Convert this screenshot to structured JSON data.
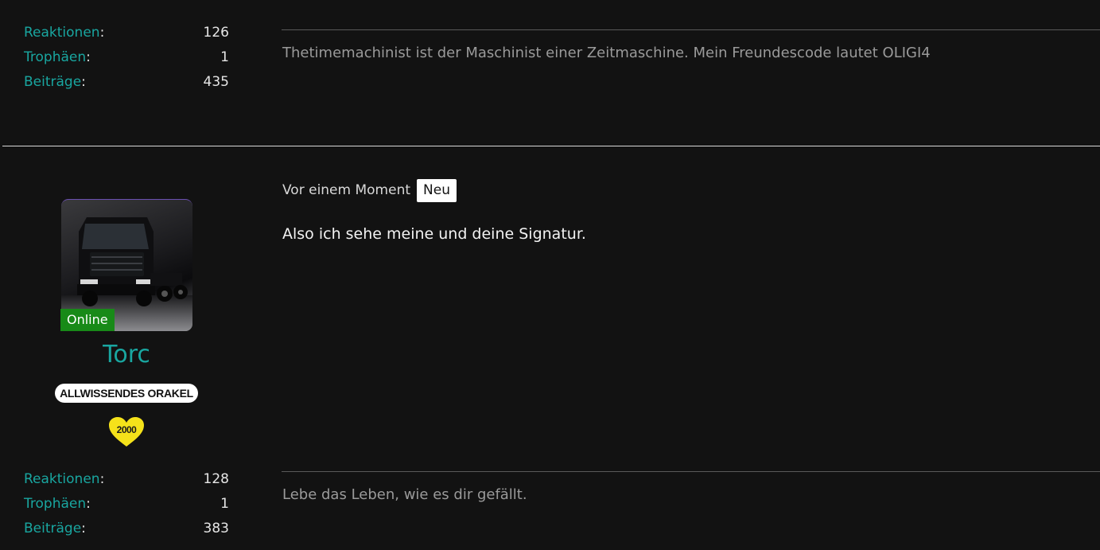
{
  "previous_post": {
    "stats": [
      {
        "label": "Reaktionen",
        "value": "126"
      },
      {
        "label": "Trophäen",
        "value": "1"
      },
      {
        "label": "Beiträge",
        "value": "435"
      }
    ],
    "signature": "Thetimemachinist ist der Maschinist einer Zeitmaschine. Mein Freundescode lautet OLIGI4"
  },
  "post": {
    "user": {
      "online_label": "Online",
      "name": "Torc",
      "rank": "ALLWISSENDES ORAKEL",
      "badge_text": "2000",
      "badge_color": "#f5e21a",
      "stats": [
        {
          "label": "Reaktionen",
          "value": "128"
        },
        {
          "label": "Trophäen",
          "value": "1"
        },
        {
          "label": "Beiträge",
          "value": "383"
        }
      ]
    },
    "time": "Vor einem Moment",
    "new_label": "Neu",
    "content": "Also ich sehe meine und deine Signatur.",
    "signature": "Lebe das Leben, wie es dir gefällt."
  }
}
